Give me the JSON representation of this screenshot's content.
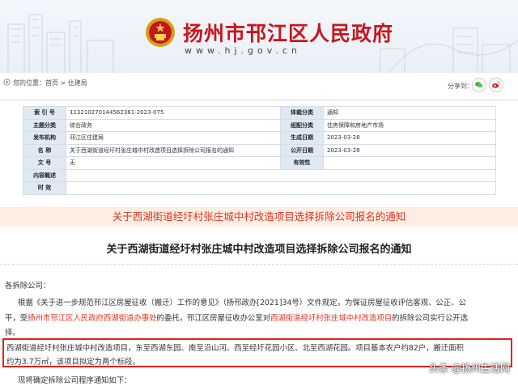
{
  "header": {
    "site_title": "扬州市邗江区人民政府",
    "site_url": "www.hj.gov.cn"
  },
  "breadcrumb": {
    "prefix": "您的位置：",
    "home": "首页",
    "sep": " > ",
    "current": "住建局"
  },
  "share": {
    "label": "分享到："
  },
  "meta": {
    "index_no_label": "索 引 号",
    "index_no": "11321027014456236​1-2023-075",
    "category_label": "体裁分类",
    "category": "通知",
    "theme_label": "主题分类",
    "theme": "综合政务",
    "org_theme_label": "组配分类",
    "org_theme": "住房保障和房地产市场",
    "publisher_label": "发布机构",
    "publisher": "邗江区住建局",
    "gen_date_label": "生成日期",
    "gen_date": "2023-03-28",
    "name_label": "名    称",
    "name": "关于西湖街道经圩村张庄城中村改造项目选择拆除公司报名的通知",
    "pub_date_label": "公开日期",
    "pub_date": "2023-03-28",
    "docno_label": "文    号",
    "docno": "无",
    "valid_label": "有效性",
    "valid": "",
    "summary_label": "内容概述",
    "summary": "",
    "time_label": "时    效",
    "time": ""
  },
  "banner_title": "关于西湖街道经圩村张庄城中村改造项目选择拆除公司报名的通知",
  "article_title": "关于西湖街道经圩村张庄城中村改造项目选择拆除公司报名的通知",
  "body": {
    "salutation": "各拆除公司：",
    "p1_a": "根据《关于进一步规范邗江区房屋征收（搬迁）工作的意见》（扬邗政办[2021]34号）文件规定，为保证房屋征收评估客观、公正、公",
    "p1_b1": "平，受",
    "p1_b_hl1": "扬州市邗江区人民政府西湖街道办事处",
    "p1_b2": "的委托，邗江区房屋征收办公室对",
    "p1_b_hl2": "西湖街道经圩村张庄城中村改造项目",
    "p1_b3": "的拆除公司实行公开选",
    "p1_c": "择。",
    "p2_a": "西湖街道经圩村张庄城中村改造项目，东至西湖东园、南至沿山河、西至经圩花园小区、北至西湖花园。项目基本农户约82户，搬迁面积",
    "p2_b": "约为3.7万㎡，该项目拟定为两个标段。",
    "p3": "现将确定拆除公司程序通知如下："
  },
  "watermark": "头条 @扬州生活网"
}
